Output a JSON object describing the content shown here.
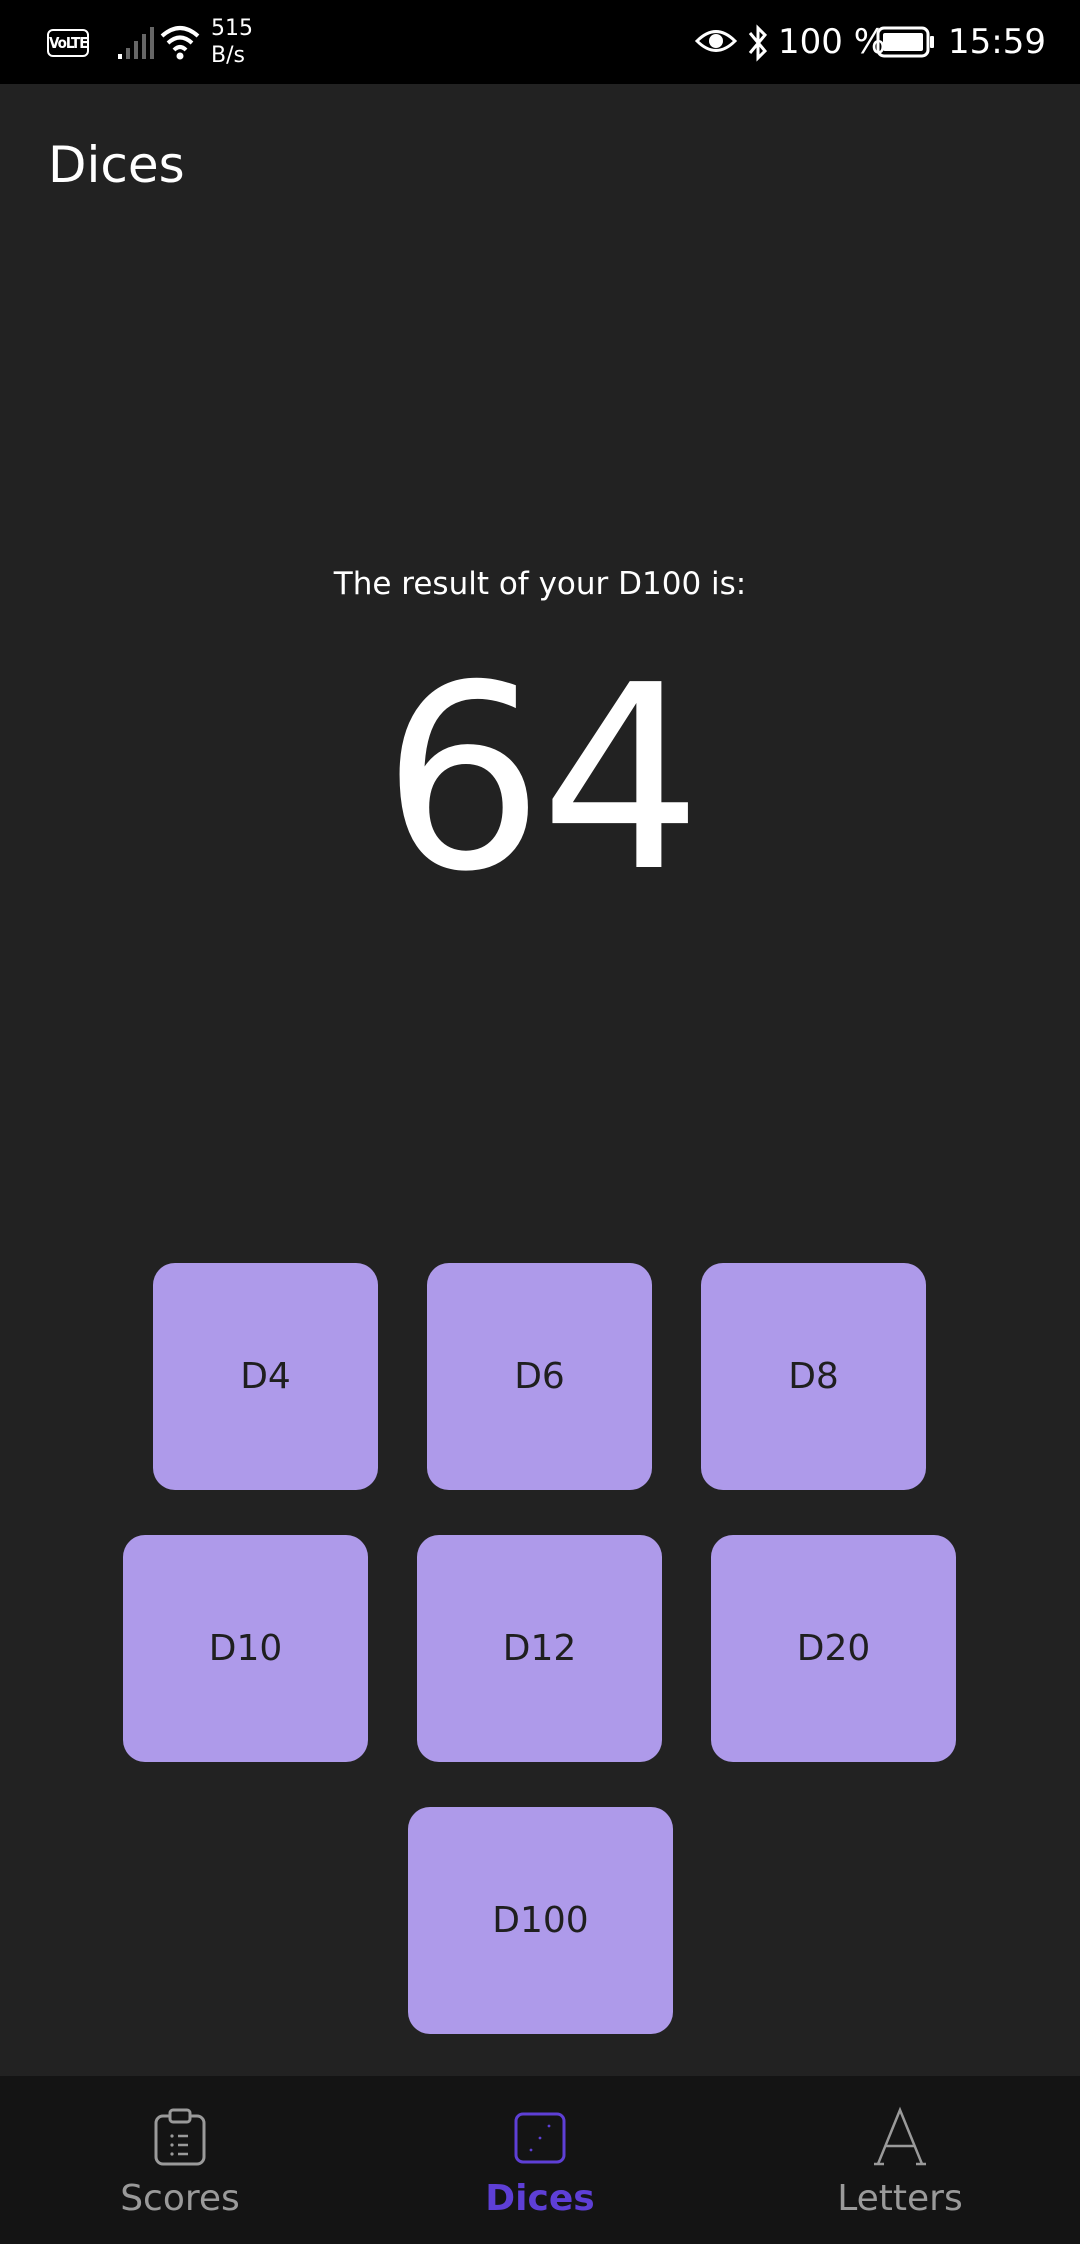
{
  "status_bar": {
    "volte": "VoLTE",
    "speed_value": "515",
    "speed_unit": "B/s",
    "battery_percent": "100 %",
    "time": "15:59",
    "icons": [
      "volte-icon",
      "signal-icon",
      "wifi-icon",
      "eye-icon",
      "bluetooth-icon",
      "battery-icon"
    ]
  },
  "header": {
    "title": "Dices"
  },
  "result": {
    "label": "The result of your D100 is:",
    "value": "64"
  },
  "dice": {
    "d4": "D4",
    "d6": "D6",
    "d8": "D8",
    "d10": "D10",
    "d12": "D12",
    "d20": "D20",
    "d100": "D100"
  },
  "bottom_nav": {
    "items": [
      {
        "label": "Scores",
        "icon": "clipboard-icon",
        "active": false
      },
      {
        "label": "Dices",
        "icon": "dice-icon",
        "active": true
      },
      {
        "label": "Letters",
        "icon": "letter-a-icon",
        "active": false
      }
    ]
  },
  "colors": {
    "background": "#222222",
    "dice_button": "#ae9aea",
    "active_nav": "#5e3fd6",
    "inactive_nav": "#9a9a9a"
  }
}
